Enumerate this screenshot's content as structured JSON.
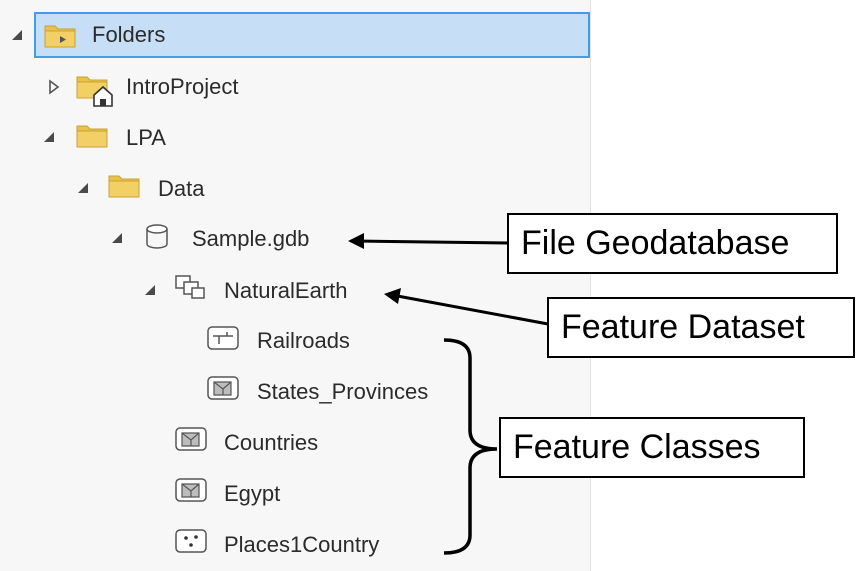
{
  "tree": {
    "root": {
      "label": "Folders",
      "icon": "folder-icon"
    },
    "items": [
      {
        "label": "IntroProject",
        "icon": "project-folder-home-icon"
      },
      {
        "label": "LPA",
        "icon": "folder-icon"
      },
      {
        "label": "Data",
        "icon": "folder-icon"
      },
      {
        "label": "Sample.gdb",
        "icon": "geodatabase-icon"
      },
      {
        "label": "NaturalEarth",
        "icon": "feature-dataset-icon"
      },
      {
        "label": "Railroads",
        "icon": "line-feature-class-icon"
      },
      {
        "label": "States_Provinces",
        "icon": "polygon-feature-class-icon"
      },
      {
        "label": "Countries",
        "icon": "polygon-feature-class-icon"
      },
      {
        "label": "Egypt",
        "icon": "polygon-feature-class-icon"
      },
      {
        "label": "Places1Country",
        "icon": "point-feature-class-icon"
      }
    ]
  },
  "callouts": {
    "file_geodatabase": "File Geodatabase",
    "feature_dataset": "Feature Dataset",
    "feature_classes": "Feature Classes"
  },
  "colors": {
    "folder": "#e8c24a",
    "selection_bg": "#c6dff7",
    "selection_border": "#3f9ee8"
  }
}
